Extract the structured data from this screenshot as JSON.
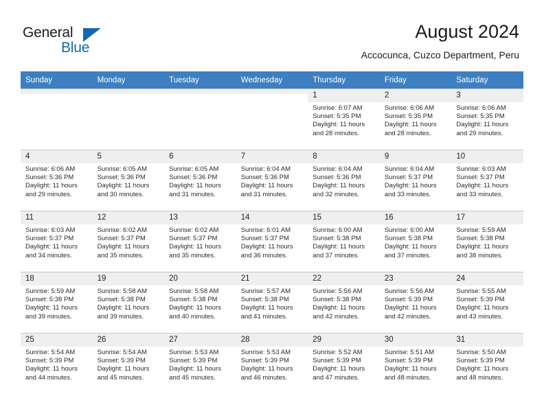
{
  "brand": {
    "name_part1": "General",
    "name_part2": "Blue",
    "accent_color": "#1268b3"
  },
  "header": {
    "title": "August 2024",
    "location": "Accocunca, Cuzco Department, Peru",
    "header_bg_color": "#3d7fc1",
    "daynum_bg_color": "#efefef"
  },
  "calendar": {
    "weekday_headers": [
      "Sunday",
      "Monday",
      "Tuesday",
      "Wednesday",
      "Thursday",
      "Friday",
      "Saturday"
    ],
    "weeks": [
      [
        {
          "day": "",
          "empty": true,
          "sunrise": "",
          "sunset": "",
          "daylight1": "",
          "daylight2": ""
        },
        {
          "day": "",
          "empty": true,
          "sunrise": "",
          "sunset": "",
          "daylight1": "",
          "daylight2": ""
        },
        {
          "day": "",
          "empty": true,
          "sunrise": "",
          "sunset": "",
          "daylight1": "",
          "daylight2": ""
        },
        {
          "day": "",
          "empty": true,
          "sunrise": "",
          "sunset": "",
          "daylight1": "",
          "daylight2": ""
        },
        {
          "day": "1",
          "empty": false,
          "sunrise": "Sunrise: 6:07 AM",
          "sunset": "Sunset: 5:35 PM",
          "daylight1": "Daylight: 11 hours",
          "daylight2": "and 28 minutes."
        },
        {
          "day": "2",
          "empty": false,
          "sunrise": "Sunrise: 6:06 AM",
          "sunset": "Sunset: 5:35 PM",
          "daylight1": "Daylight: 11 hours",
          "daylight2": "and 28 minutes."
        },
        {
          "day": "3",
          "empty": false,
          "sunrise": "Sunrise: 6:06 AM",
          "sunset": "Sunset: 5:35 PM",
          "daylight1": "Daylight: 11 hours",
          "daylight2": "and 29 minutes."
        }
      ],
      [
        {
          "day": "4",
          "empty": false,
          "sunrise": "Sunrise: 6:06 AM",
          "sunset": "Sunset: 5:36 PM",
          "daylight1": "Daylight: 11 hours",
          "daylight2": "and 29 minutes."
        },
        {
          "day": "5",
          "empty": false,
          "sunrise": "Sunrise: 6:05 AM",
          "sunset": "Sunset: 5:36 PM",
          "daylight1": "Daylight: 11 hours",
          "daylight2": "and 30 minutes."
        },
        {
          "day": "6",
          "empty": false,
          "sunrise": "Sunrise: 6:05 AM",
          "sunset": "Sunset: 5:36 PM",
          "daylight1": "Daylight: 11 hours",
          "daylight2": "and 31 minutes."
        },
        {
          "day": "7",
          "empty": false,
          "sunrise": "Sunrise: 6:04 AM",
          "sunset": "Sunset: 5:36 PM",
          "daylight1": "Daylight: 11 hours",
          "daylight2": "and 31 minutes."
        },
        {
          "day": "8",
          "empty": false,
          "sunrise": "Sunrise: 6:04 AM",
          "sunset": "Sunset: 5:36 PM",
          "daylight1": "Daylight: 11 hours",
          "daylight2": "and 32 minutes."
        },
        {
          "day": "9",
          "empty": false,
          "sunrise": "Sunrise: 6:04 AM",
          "sunset": "Sunset: 5:37 PM",
          "daylight1": "Daylight: 11 hours",
          "daylight2": "and 33 minutes."
        },
        {
          "day": "10",
          "empty": false,
          "sunrise": "Sunrise: 6:03 AM",
          "sunset": "Sunset: 5:37 PM",
          "daylight1": "Daylight: 11 hours",
          "daylight2": "and 33 minutes."
        }
      ],
      [
        {
          "day": "11",
          "empty": false,
          "sunrise": "Sunrise: 6:03 AM",
          "sunset": "Sunset: 5:37 PM",
          "daylight1": "Daylight: 11 hours",
          "daylight2": "and 34 minutes."
        },
        {
          "day": "12",
          "empty": false,
          "sunrise": "Sunrise: 6:02 AM",
          "sunset": "Sunset: 5:37 PM",
          "daylight1": "Daylight: 11 hours",
          "daylight2": "and 35 minutes."
        },
        {
          "day": "13",
          "empty": false,
          "sunrise": "Sunrise: 6:02 AM",
          "sunset": "Sunset: 5:37 PM",
          "daylight1": "Daylight: 11 hours",
          "daylight2": "and 35 minutes."
        },
        {
          "day": "14",
          "empty": false,
          "sunrise": "Sunrise: 6:01 AM",
          "sunset": "Sunset: 5:37 PM",
          "daylight1": "Daylight: 11 hours",
          "daylight2": "and 36 minutes."
        },
        {
          "day": "15",
          "empty": false,
          "sunrise": "Sunrise: 6:00 AM",
          "sunset": "Sunset: 5:38 PM",
          "daylight1": "Daylight: 11 hours",
          "daylight2": "and 37 minutes."
        },
        {
          "day": "16",
          "empty": false,
          "sunrise": "Sunrise: 6:00 AM",
          "sunset": "Sunset: 5:38 PM",
          "daylight1": "Daylight: 11 hours",
          "daylight2": "and 37 minutes."
        },
        {
          "day": "17",
          "empty": false,
          "sunrise": "Sunrise: 5:59 AM",
          "sunset": "Sunset: 5:38 PM",
          "daylight1": "Daylight: 11 hours",
          "daylight2": "and 38 minutes."
        }
      ],
      [
        {
          "day": "18",
          "empty": false,
          "sunrise": "Sunrise: 5:59 AM",
          "sunset": "Sunset: 5:38 PM",
          "daylight1": "Daylight: 11 hours",
          "daylight2": "and 39 minutes."
        },
        {
          "day": "19",
          "empty": false,
          "sunrise": "Sunrise: 5:58 AM",
          "sunset": "Sunset: 5:38 PM",
          "daylight1": "Daylight: 11 hours",
          "daylight2": "and 39 minutes."
        },
        {
          "day": "20",
          "empty": false,
          "sunrise": "Sunrise: 5:58 AM",
          "sunset": "Sunset: 5:38 PM",
          "daylight1": "Daylight: 11 hours",
          "daylight2": "and 40 minutes."
        },
        {
          "day": "21",
          "empty": false,
          "sunrise": "Sunrise: 5:57 AM",
          "sunset": "Sunset: 5:38 PM",
          "daylight1": "Daylight: 11 hours",
          "daylight2": "and 41 minutes."
        },
        {
          "day": "22",
          "empty": false,
          "sunrise": "Sunrise: 5:56 AM",
          "sunset": "Sunset: 5:38 PM",
          "daylight1": "Daylight: 11 hours",
          "daylight2": "and 42 minutes."
        },
        {
          "day": "23",
          "empty": false,
          "sunrise": "Sunrise: 5:56 AM",
          "sunset": "Sunset: 5:39 PM",
          "daylight1": "Daylight: 11 hours",
          "daylight2": "and 42 minutes."
        },
        {
          "day": "24",
          "empty": false,
          "sunrise": "Sunrise: 5:55 AM",
          "sunset": "Sunset: 5:39 PM",
          "daylight1": "Daylight: 11 hours",
          "daylight2": "and 43 minutes."
        }
      ],
      [
        {
          "day": "25",
          "empty": false,
          "sunrise": "Sunrise: 5:54 AM",
          "sunset": "Sunset: 5:39 PM",
          "daylight1": "Daylight: 11 hours",
          "daylight2": "and 44 minutes."
        },
        {
          "day": "26",
          "empty": false,
          "sunrise": "Sunrise: 5:54 AM",
          "sunset": "Sunset: 5:39 PM",
          "daylight1": "Daylight: 11 hours",
          "daylight2": "and 45 minutes."
        },
        {
          "day": "27",
          "empty": false,
          "sunrise": "Sunrise: 5:53 AM",
          "sunset": "Sunset: 5:39 PM",
          "daylight1": "Daylight: 11 hours",
          "daylight2": "and 45 minutes."
        },
        {
          "day": "28",
          "empty": false,
          "sunrise": "Sunrise: 5:53 AM",
          "sunset": "Sunset: 5:39 PM",
          "daylight1": "Daylight: 11 hours",
          "daylight2": "and 46 minutes."
        },
        {
          "day": "29",
          "empty": false,
          "sunrise": "Sunrise: 5:52 AM",
          "sunset": "Sunset: 5:39 PM",
          "daylight1": "Daylight: 11 hours",
          "daylight2": "and 47 minutes."
        },
        {
          "day": "30",
          "empty": false,
          "sunrise": "Sunrise: 5:51 AM",
          "sunset": "Sunset: 5:39 PM",
          "daylight1": "Daylight: 11 hours",
          "daylight2": "and 48 minutes."
        },
        {
          "day": "31",
          "empty": false,
          "sunrise": "Sunrise: 5:50 AM",
          "sunset": "Sunset: 5:39 PM",
          "daylight1": "Daylight: 11 hours",
          "daylight2": "and 48 minutes."
        }
      ]
    ]
  }
}
